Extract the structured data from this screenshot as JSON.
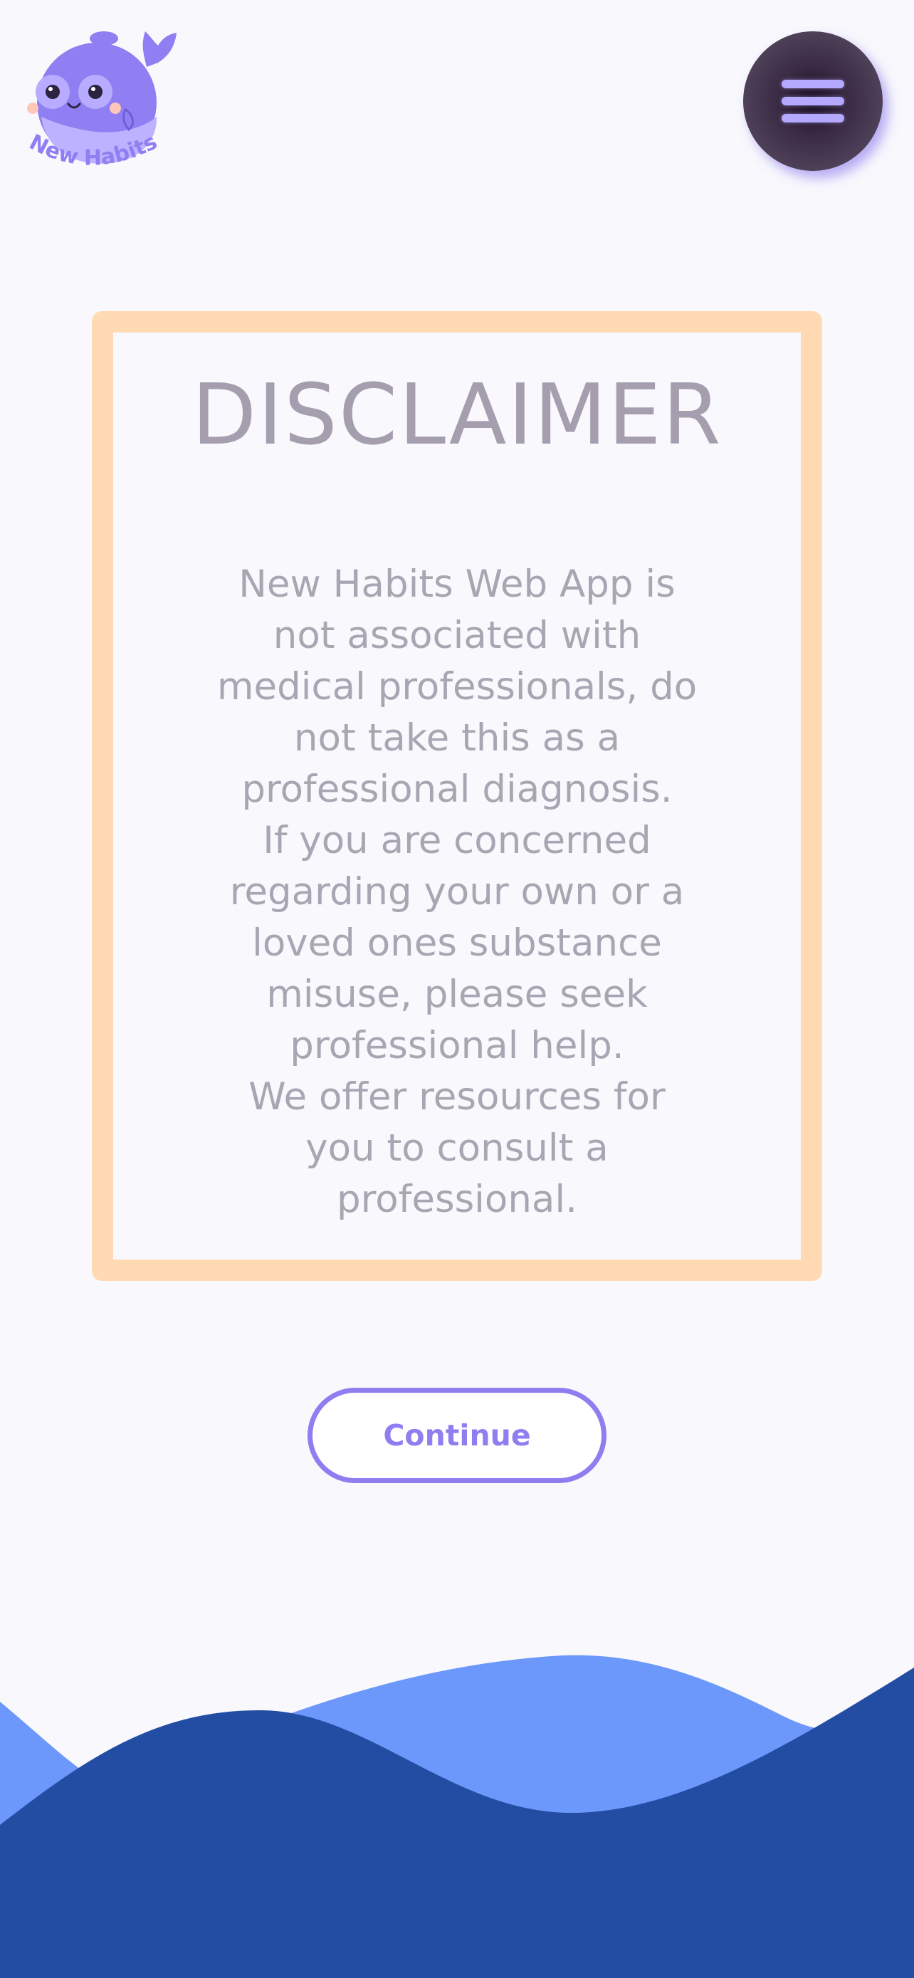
{
  "app": {
    "logo_text": "New Habits"
  },
  "header": {
    "menu_icon": "hamburger-menu-icon"
  },
  "disclaimer": {
    "title": "DISCLAIMER",
    "body": "New Habits Web App is\nnot associated with\nmedical professionals, do\nnot take this as a\nprofessional diagnosis.\nIf you are concerned\nregarding your own or a\nloved ones substance\nmisuse, please seek\nprofessional help.\nWe offer resources for\nyou to consult a\nprofessional."
  },
  "actions": {
    "continue_label": "Continue"
  },
  "colors": {
    "background": "#F8F8FD",
    "frame": "#FFDAB3",
    "accent": "#8E7EF0",
    "menu_bars": "#B4A9FF",
    "wave_light": "#6C98FB",
    "wave_dark": "#224DA3"
  }
}
